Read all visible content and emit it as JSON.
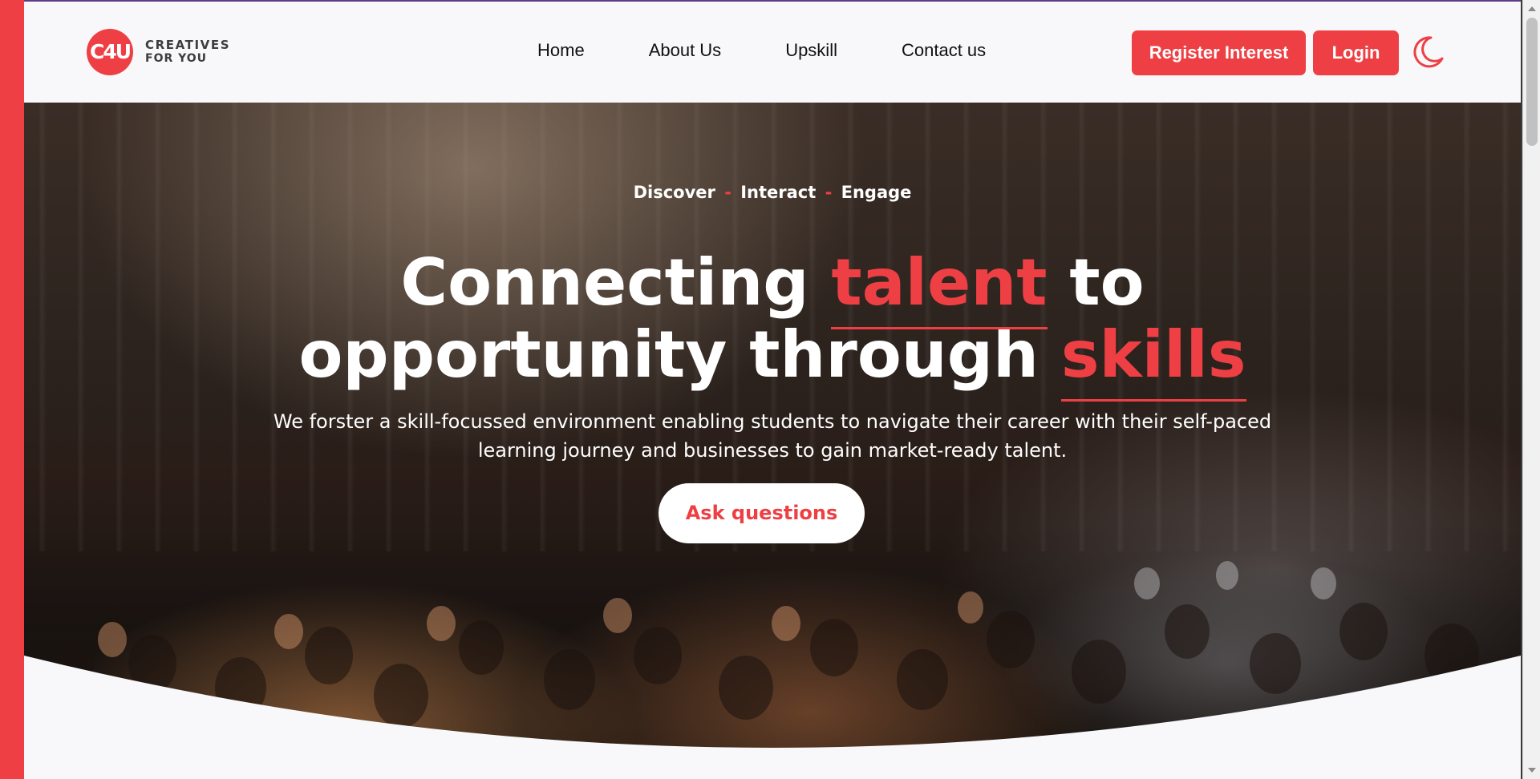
{
  "brand": {
    "logo_mark": "C4U",
    "name_line1": "CREATIVES",
    "name_line2": "FOR YOU",
    "accent_color": "#ee4044"
  },
  "nav": {
    "items": [
      {
        "label": "Home"
      },
      {
        "label": "About Us"
      },
      {
        "label": "Upskill"
      },
      {
        "label": "Contact us"
      }
    ]
  },
  "header_actions": {
    "register_label": "Register Interest",
    "login_label": "Login",
    "theme_toggle_icon": "moon-icon"
  },
  "hero": {
    "tagline": [
      "Discover",
      "Interact",
      "Engage"
    ],
    "tagline_separator": "-",
    "headline": {
      "part1": "Connecting ",
      "accent1": "talent",
      "part2": " to",
      "part3": "opportunity through ",
      "accent2": "skills"
    },
    "subtext": "We forster a skill-focussed environment enabling students to navigate their career with their self-paced learning journey and businesses to gain market-ready talent.",
    "cta_label": "Ask questions",
    "background": "concert crowd photo"
  }
}
